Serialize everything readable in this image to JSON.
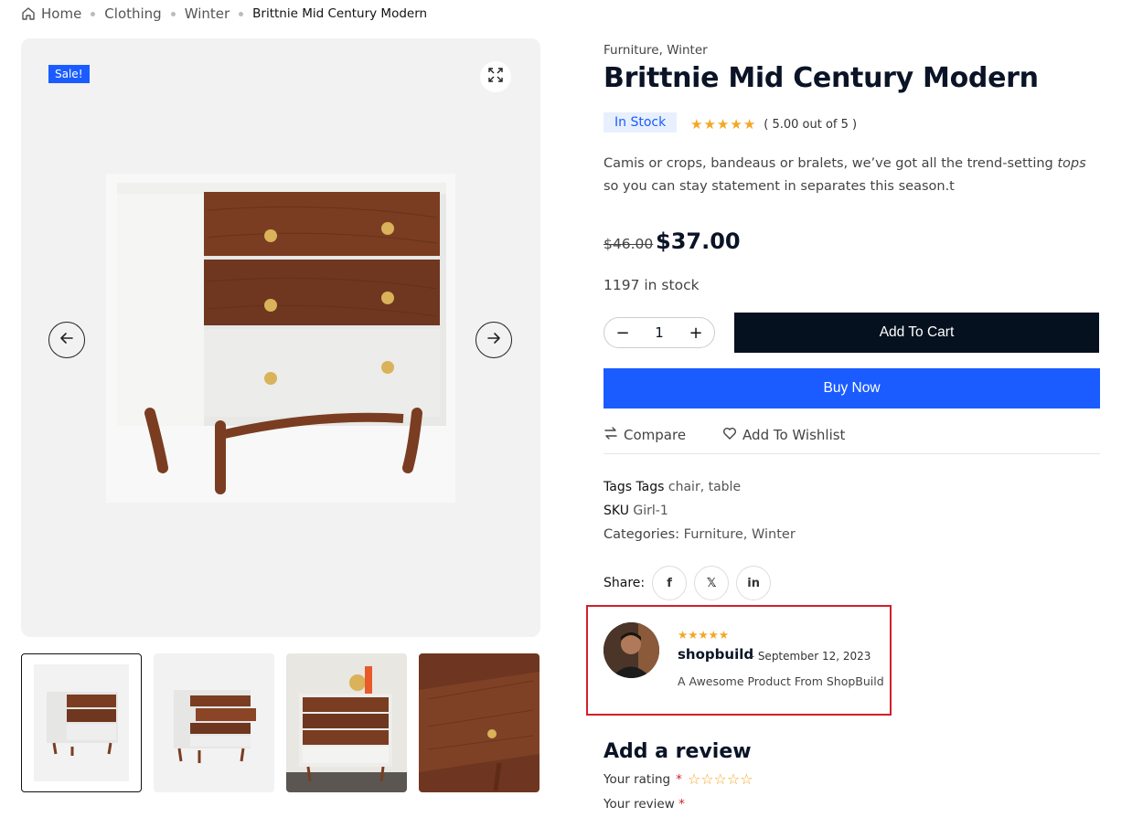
{
  "breadcrumb": {
    "home": "Home",
    "items": [
      "Clothing",
      "Winter"
    ],
    "current": "Brittnie Mid Century Modern"
  },
  "gallery": {
    "sale_badge": "Sale!",
    "thumbnails": [
      "dresser-front",
      "dresser-open-drawers",
      "dresser-room-scene",
      "drawer-closeup"
    ]
  },
  "product": {
    "categories_top": "Furniture, Winter",
    "title": "Brittnie Mid Century Modern",
    "stock_badge": "In Stock",
    "rating_stars": 5,
    "rating_text": "( 5.00 out of 5 )",
    "description_before": "Camis or crops, bandeaus or bralets, we’ve got all the trend-setting ",
    "description_em": "tops",
    "description_after": " so you can stay statement in separates this season.t",
    "old_price": "$46.00",
    "new_price": "$37.00",
    "stock_count": "1197 in stock",
    "quantity": "1",
    "qty_minus": "−",
    "qty_plus": "+",
    "add_to_cart": "Add To Cart",
    "buy_now": "Buy Now",
    "compare": "Compare",
    "wishlist": "Add To Wishlist"
  },
  "meta": {
    "tags_label": "Tags Tags",
    "tags_value": "chair, table",
    "sku_label": "SKU",
    "sku_value": "Girl-1",
    "categories_label": "Categories:",
    "categories_value": "Furniture, Winter"
  },
  "share": {
    "label": "Share:",
    "facebook": "f",
    "x": "𝕏",
    "linkedin": "in"
  },
  "review": {
    "stars": 5,
    "author": "shopbuild",
    "date": "– September 12, 2023",
    "text": "A Awesome Product From ShopBuild"
  },
  "review_form": {
    "heading": "Add a review",
    "rating_label": "Your rating",
    "review_label": "Your review",
    "required_mark": "*"
  },
  "colors": {
    "accent": "#1a5cff",
    "dark": "#05111f",
    "star": "#f5a623",
    "highlight": "#d0202a"
  }
}
